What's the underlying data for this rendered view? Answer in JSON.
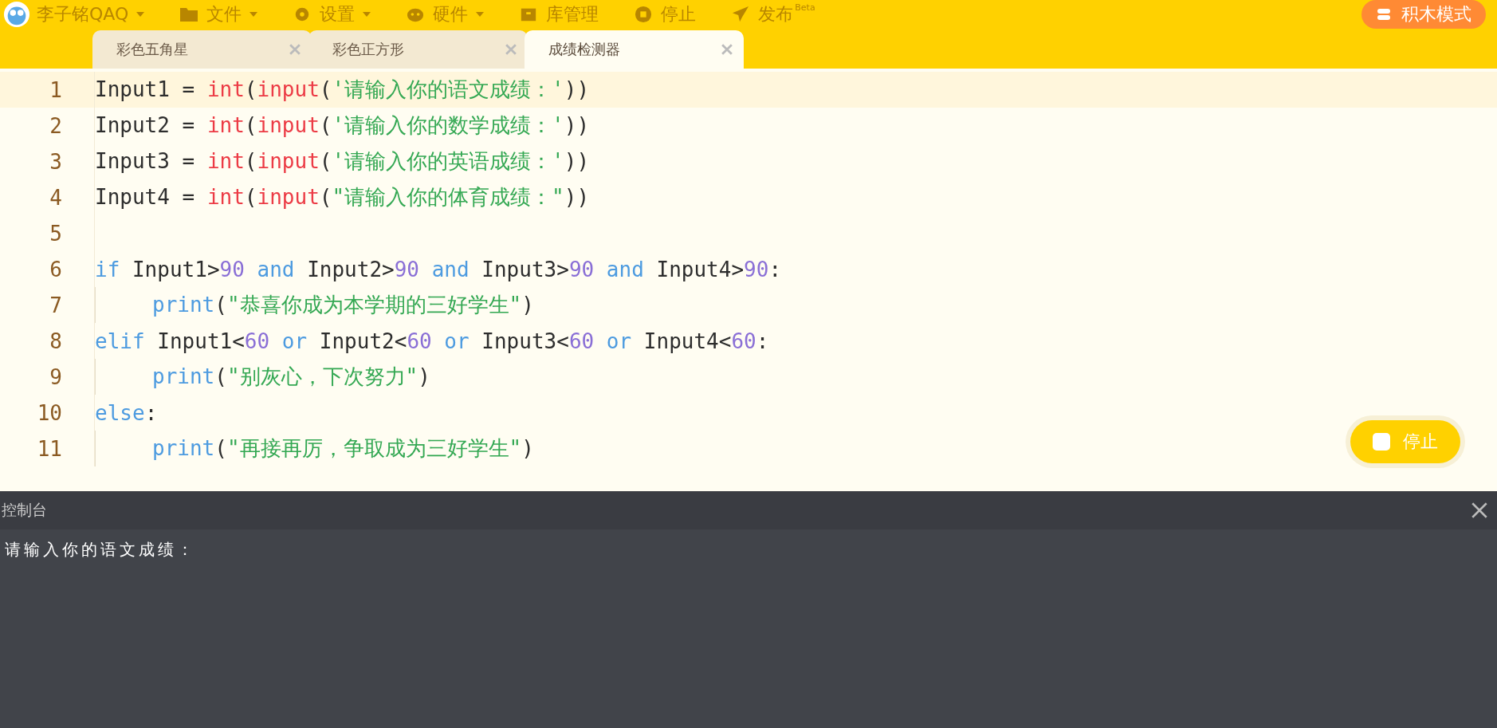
{
  "menu_bar": {
    "user": "李子铭QAQ",
    "items": [
      {
        "label": "文件",
        "kind": "file",
        "dropdown": true
      },
      {
        "label": "设置",
        "kind": "settings",
        "dropdown": true
      },
      {
        "label": "硬件",
        "kind": "hardware",
        "dropdown": true
      },
      {
        "label": "库管理",
        "kind": "library",
        "dropdown": false
      },
      {
        "label": "停止",
        "kind": "stop",
        "dropdown": false
      },
      {
        "label": "发布",
        "kind": "publish",
        "dropdown": false,
        "sup": "Beta"
      }
    ],
    "mode_button": "积木模式"
  },
  "tabs": [
    {
      "label": "彩色五角星",
      "selected": false
    },
    {
      "label": "彩色正方形",
      "selected": false
    },
    {
      "label": "成绩检测器",
      "selected": true
    }
  ],
  "editor": {
    "lines": [
      {
        "number": "1",
        "current": true,
        "indented": false,
        "tokens": [
          {
            "kind": "plain",
            "text": "Input1 = "
          },
          {
            "kind": "builtin",
            "text": "int"
          },
          {
            "kind": "plain",
            "text": "("
          },
          {
            "kind": "builtin",
            "text": "input"
          },
          {
            "kind": "plain",
            "text": "("
          },
          {
            "kind": "string",
            "text": "'请输入你的语文成绩：'"
          },
          {
            "kind": "plain",
            "text": "))"
          }
        ]
      },
      {
        "number": "2",
        "current": false,
        "indented": false,
        "tokens": [
          {
            "kind": "plain",
            "text": "Input2 = "
          },
          {
            "kind": "builtin",
            "text": "int"
          },
          {
            "kind": "plain",
            "text": "("
          },
          {
            "kind": "builtin",
            "text": "input"
          },
          {
            "kind": "plain",
            "text": "("
          },
          {
            "kind": "string",
            "text": "'请输入你的数学成绩：'"
          },
          {
            "kind": "plain",
            "text": "))"
          }
        ]
      },
      {
        "number": "3",
        "current": false,
        "indented": false,
        "tokens": [
          {
            "kind": "plain",
            "text": "Input3 = "
          },
          {
            "kind": "builtin",
            "text": "int"
          },
          {
            "kind": "plain",
            "text": "("
          },
          {
            "kind": "builtin",
            "text": "input"
          },
          {
            "kind": "plain",
            "text": "("
          },
          {
            "kind": "string",
            "text": "'请输入你的英语成绩：'"
          },
          {
            "kind": "plain",
            "text": "))"
          }
        ]
      },
      {
        "number": "4",
        "current": false,
        "indented": false,
        "tokens": [
          {
            "kind": "plain",
            "text": "Input4 = "
          },
          {
            "kind": "builtin",
            "text": "int"
          },
          {
            "kind": "plain",
            "text": "("
          },
          {
            "kind": "builtin",
            "text": "input"
          },
          {
            "kind": "plain",
            "text": "("
          },
          {
            "kind": "string",
            "text": "\"请输入你的体育成绩：\""
          },
          {
            "kind": "plain",
            "text": "))"
          }
        ]
      },
      {
        "number": "5",
        "current": false,
        "indented": false
      },
      {
        "number": "6",
        "current": false,
        "indented": false,
        "tokens": [
          {
            "kind": "keyword",
            "text": "if"
          },
          {
            "kind": "plain",
            "text": " Input1>"
          },
          {
            "kind": "number",
            "text": "90"
          },
          {
            "kind": "keyword",
            "text": " and"
          },
          {
            "kind": "plain",
            "text": " Input2>"
          },
          {
            "kind": "number",
            "text": "90"
          },
          {
            "kind": "keyword",
            "text": " and"
          },
          {
            "kind": "plain",
            "text": " Input3>"
          },
          {
            "kind": "number",
            "text": "90"
          },
          {
            "kind": "keyword",
            "text": " and"
          },
          {
            "kind": "plain",
            "text": " Input4>"
          },
          {
            "kind": "number",
            "text": "90"
          },
          {
            "kind": "plain",
            "text": ":"
          }
        ]
      },
      {
        "number": "7",
        "current": false,
        "indented": true,
        "tokens": [
          {
            "kind": "keyword",
            "text": "print"
          },
          {
            "kind": "plain",
            "text": "("
          },
          {
            "kind": "string",
            "text": "\"恭喜你成为本学期的三好学生\""
          },
          {
            "kind": "plain",
            "text": ")"
          }
        ]
      },
      {
        "number": "8",
        "current": false,
        "indented": false,
        "tokens": [
          {
            "kind": "keyword",
            "text": "elif"
          },
          {
            "kind": "plain",
            "text": " Input1<"
          },
          {
            "kind": "number",
            "text": "60"
          },
          {
            "kind": "keyword",
            "text": " or"
          },
          {
            "kind": "plain",
            "text": " Input2<"
          },
          {
            "kind": "number",
            "text": "60"
          },
          {
            "kind": "keyword",
            "text": " or"
          },
          {
            "kind": "plain",
            "text": " Input3<"
          },
          {
            "kind": "number",
            "text": "60"
          },
          {
            "kind": "keyword",
            "text": " or"
          },
          {
            "kind": "plain",
            "text": " Input4<"
          },
          {
            "kind": "number",
            "text": "60"
          },
          {
            "kind": "plain",
            "text": ":"
          }
        ]
      },
      {
        "number": "9",
        "current": false,
        "indented": true,
        "tokens": [
          {
            "kind": "keyword",
            "text": "print"
          },
          {
            "kind": "plain",
            "text": "("
          },
          {
            "kind": "string",
            "text": "\"别灰心，下次努力\""
          },
          {
            "kind": "plain",
            "text": ")"
          }
        ]
      },
      {
        "number": "10",
        "current": false,
        "indented": false,
        "tokens": [
          {
            "kind": "keyword",
            "text": "else"
          },
          {
            "kind": "plain",
            "text": ":"
          }
        ]
      },
      {
        "number": "11",
        "current": false,
        "indented": true,
        "tokens": [
          {
            "kind": "keyword",
            "text": "print"
          },
          {
            "kind": "plain",
            "text": "("
          },
          {
            "kind": "string",
            "text": "\"再接再厉，争取成为三好学生\""
          },
          {
            "kind": "plain",
            "text": ")"
          }
        ]
      }
    ]
  },
  "run_button": "停止",
  "console": {
    "title": "控制台",
    "output": "请输入你的语文成绩："
  }
}
